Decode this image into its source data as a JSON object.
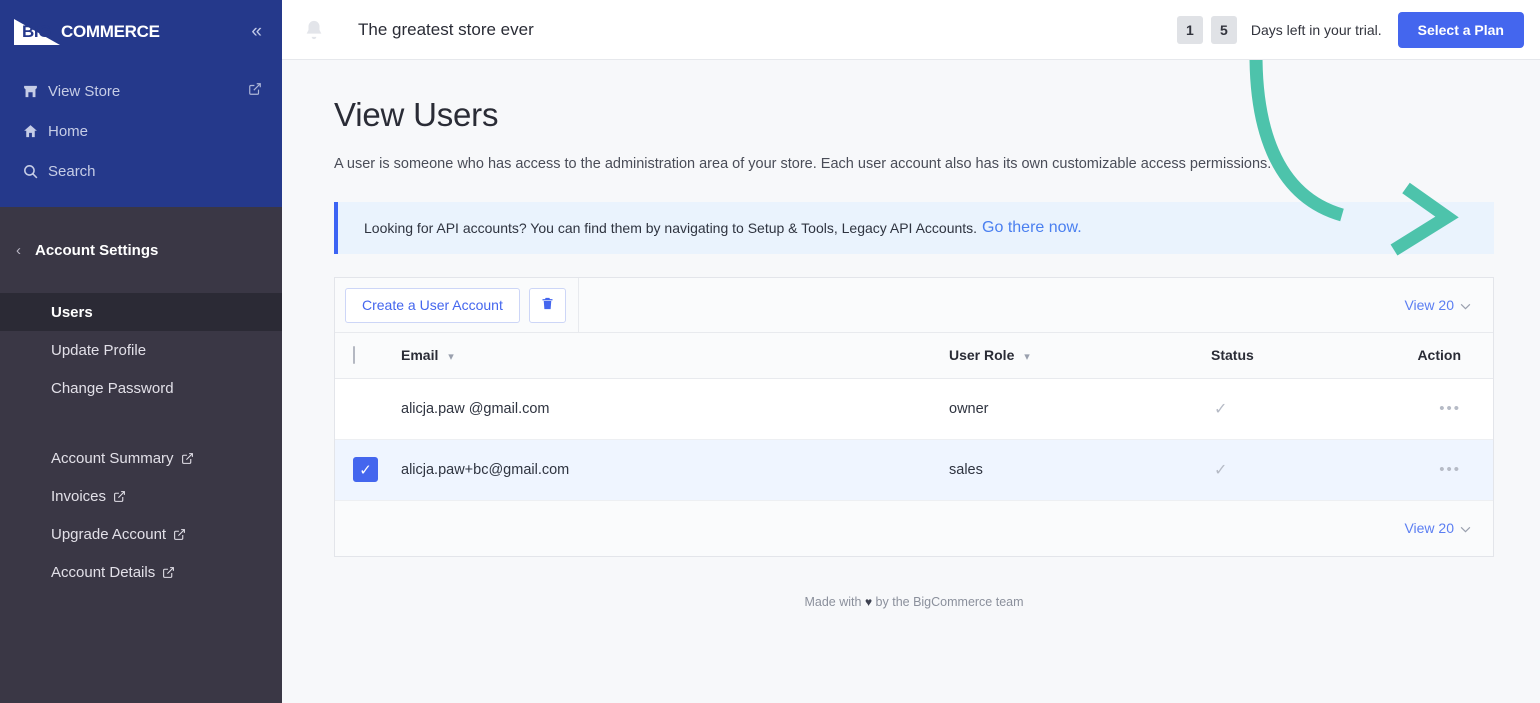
{
  "sidebar": {
    "brand": {
      "logo_big": "BIG",
      "logo_word": "COMMERCE",
      "collapse_icon": "chevron-double-left-icon"
    },
    "nav": [
      {
        "label": "View Store",
        "icon": "store-icon",
        "external": true
      },
      {
        "label": "Home",
        "icon": "home-icon",
        "external": false
      },
      {
        "label": "Search",
        "icon": "search-icon",
        "external": false
      }
    ],
    "section": {
      "back_icon": "chevron-left-icon",
      "title": "Account Settings"
    },
    "items": [
      {
        "label": "Users",
        "active": true,
        "external": false
      },
      {
        "label": "Update Profile",
        "active": false,
        "external": false
      },
      {
        "label": "Change Password",
        "active": false,
        "external": false
      }
    ],
    "items2": [
      {
        "label": "Account Summary",
        "external": true
      },
      {
        "label": "Invoices",
        "external": true
      },
      {
        "label": "Upgrade Account",
        "external": true
      },
      {
        "label": "Account Details",
        "external": true
      }
    ]
  },
  "topbar": {
    "bell_icon": "bell-icon",
    "store_title": "The greatest store ever",
    "trial_days": [
      "1",
      "5"
    ],
    "trial_text": "Days left in your trial.",
    "plan_button": "Select a Plan"
  },
  "page": {
    "title": "View Users",
    "description": "A user is someone who has access to the administration area of your store. Each user account also has its own customizable access permissions."
  },
  "banner": {
    "text": "Looking for API accounts? You can find them by navigating to Setup & Tools, Legacy API Accounts.",
    "link": "Go there now.",
    "accent_color": "#3c64f4"
  },
  "toolbar": {
    "create_button": "Create a User Account",
    "delete_icon": "trash-icon",
    "view_label": "View 20",
    "view_chevron": "chevron-down-icon"
  },
  "table": {
    "columns": [
      {
        "label": "",
        "name": "checkbox"
      },
      {
        "label": "Email",
        "sortable": true
      },
      {
        "label": "User Role",
        "sortable": true
      },
      {
        "label": "Status",
        "sortable": false
      },
      {
        "label": "Action",
        "sortable": false
      }
    ],
    "header_checkbox_checked": false,
    "rows": [
      {
        "checked": false,
        "email": "alicja.paw @gmail.com",
        "role": "owner",
        "status": "✓",
        "action": "•••"
      },
      {
        "checked": true,
        "email": "alicja.paw+bc@gmail.com",
        "role": "sales",
        "status": "✓",
        "action": "•••"
      }
    ]
  },
  "footer": {
    "view_label": "View 20",
    "made_prefix": "Made with",
    "heart": "♥",
    "made_suffix": "by the BigCommerce team"
  },
  "annotation": {
    "arrow_color": "#4dc3ab",
    "target": "row-action-menu"
  }
}
